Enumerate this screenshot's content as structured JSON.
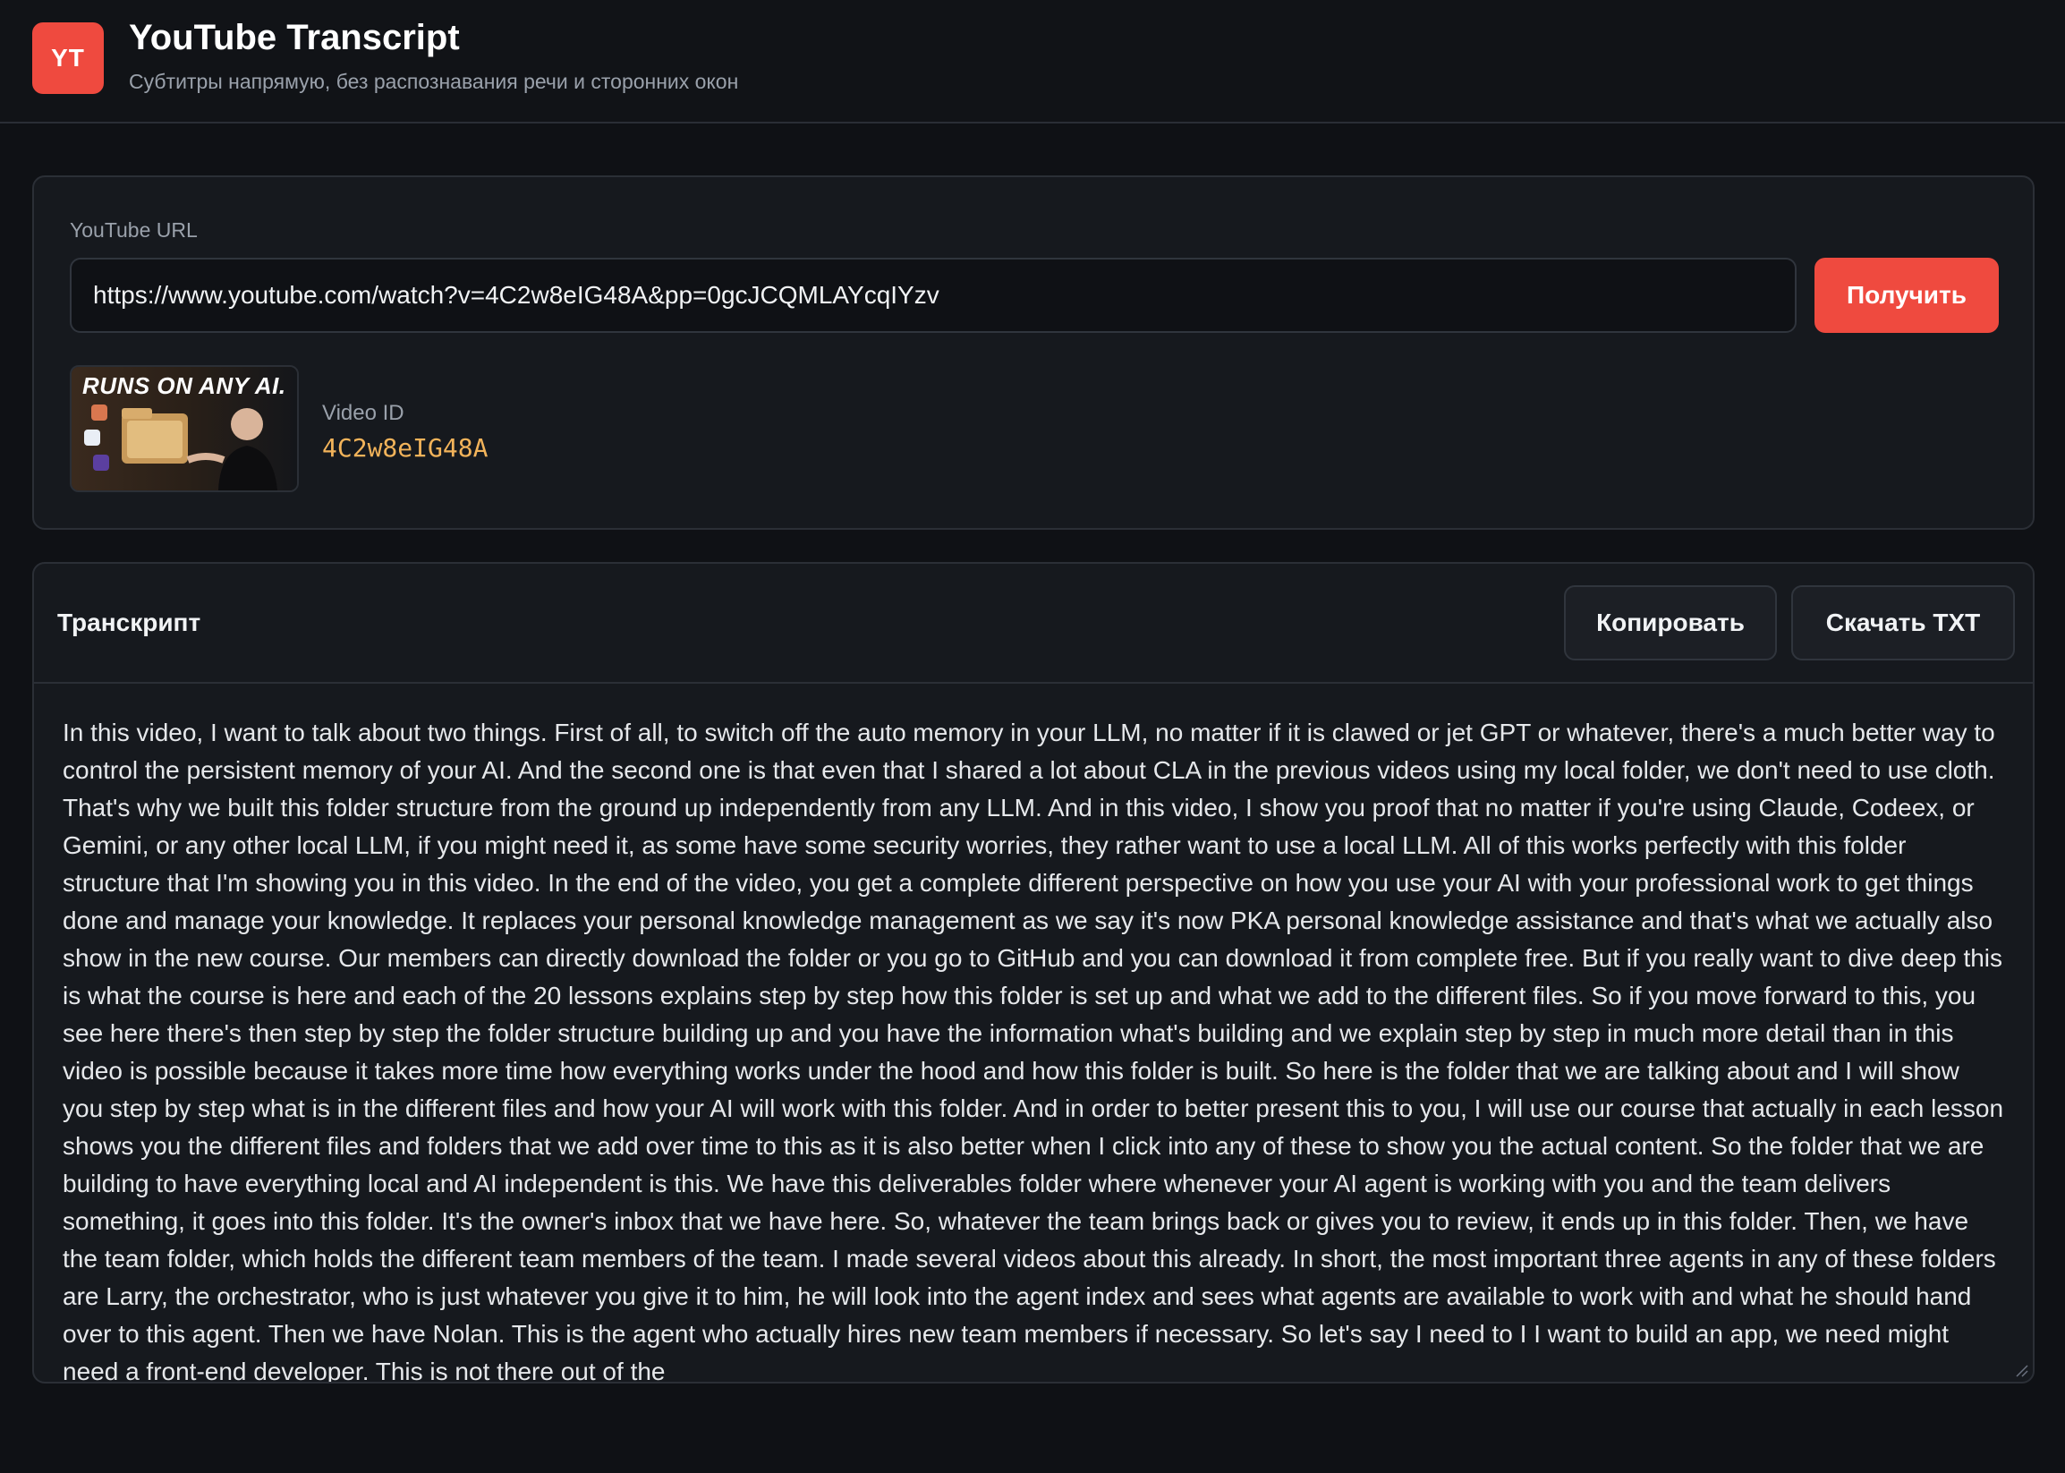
{
  "header": {
    "logo_text": "YT",
    "title": "YouTube Transcript",
    "subtitle": "Субтитры напрямую, без распознавания речи и сторонних окон"
  },
  "url_card": {
    "label": "YouTube URL",
    "url_value": "https://www.youtube.com/watch?v=4C2w8eIG48A&pp=0gcJCQMLAYcqIYzv",
    "fetch_label": "Получить",
    "thumbnail_text": "RUNS ON ANY AI.",
    "video_id_label": "Video ID",
    "video_id": "4C2w8eIG48A"
  },
  "transcript": {
    "title": "Транскрипт",
    "copy_label": "Копировать",
    "download_label": "Скачать TXT",
    "text": "In this video, I want to talk about two things. First of all, to switch off the auto memory in your LLM, no matter if it is clawed or jet GPT or whatever, there's a much better way to control the persistent memory of your AI. And the second one is that even that I shared a lot about CLA in the previous videos using my local folder, we don't need to use cloth. That's why we built this folder structure from the ground up independently from any LLM. And in this video, I show you proof that no matter if you're using Claude, Codeex, or Gemini, or any other local LLM, if you might need it, as some have some security worries, they rather want to use a local LLM. All of this works perfectly with this folder structure that I'm showing you in this video. In the end of the video, you get a complete different perspective on how you use your AI with your professional work to get things done and manage your knowledge. It replaces your personal knowledge management as we say it's now PKA personal knowledge assistance and that's what we actually also show in the new course. Our members can directly download the folder or you go to GitHub and you can download it from complete free. But if you really want to dive deep this is what the course is here and each of the 20 lessons explains step by step how this folder is set up and what we add to the different files. So if you move forward to this, you see here there's then step by step the folder structure building up and you have the information what's building and we explain step by step in much more detail than in this video is possible because it takes more time how everything works under the hood and how this folder is built. So here is the folder that we are talking about and I will show you step by step what is in the different files and how your AI will work with this folder. And in order to better present this to you, I will use our course that actually in each lesson shows you the different files and folders that we add over time to this as it is also better when I click into any of these to show you the actual content. So the folder that we are building to have everything local and AI independent is this. We have this deliverables folder where whenever your AI agent is working with you and the team delivers something, it goes into this folder. It's the owner's inbox that we have here. So, whatever the team brings back or gives you to review, it ends up in this folder. Then, we have the team folder, which holds the different team members of the team. I made several videos about this already. In short, the most important three agents in any of these folders are Larry, the orchestrator, who is just whatever you give it to him, he will look into the agent index and sees what agents are available to work with and what he should hand over to this agent. Then we have Nolan. This is the agent who actually hires new team members if necessary. So let's say I need to I I want to build an app, we need might need a front-end developer. This is not there out of the"
  }
}
